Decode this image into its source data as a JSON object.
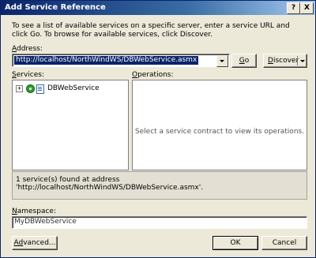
{
  "window": {
    "title": "Add Service Reference",
    "help_glyph": "?",
    "close_glyph": "X"
  },
  "description": "To see a list of available services on a specific server, enter a service URL and click Go. To browse for available services, click Discover.",
  "address": {
    "label_accel": "A",
    "label_rest": "ddress:",
    "value": "http://localhost/NorthWindWS/DBWebService.asmx"
  },
  "buttons": {
    "go_accel": "G",
    "go_rest": "o",
    "discover_accel": "D",
    "discover_rest": "iscover",
    "advanced_accel": "Ad",
    "advanced_pre": "",
    "advanced_rest": "vanced...",
    "ok": "OK",
    "cancel": "Cancel"
  },
  "services": {
    "label_accel": "S",
    "label_rest": "ervices:",
    "expander_glyph": "+",
    "items": [
      {
        "label": "DBWebService"
      }
    ]
  },
  "operations": {
    "label_accel": "O",
    "label_rest": "perations:",
    "hint": "Select a service contract to view its operations."
  },
  "status_text": "1 service(s) found at address 'http://localhost/NorthWindWS/DBWebService.asmx'.",
  "namespace": {
    "label_accel": "N",
    "label_rest": "amespace:",
    "value": "MyDBWebService"
  }
}
